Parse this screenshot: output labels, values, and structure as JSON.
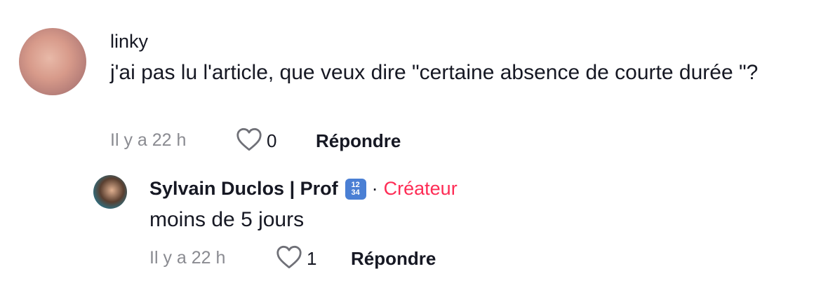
{
  "comment": {
    "username": "linky",
    "text": "j'ai pas lu l'article, que veux dire \"certaine absence de courte durée \"?",
    "time": "Il y a 22 h",
    "likes": "0",
    "reply_label": "Répondre",
    "avatar_icon": "user-avatar"
  },
  "reply": {
    "username": "Sylvain Duclos | Prof",
    "emoji": "1234",
    "separator": "·",
    "creator_badge": "Créateur",
    "text": "moins de 5 jours",
    "time": "Il y a 22 h",
    "likes": "1",
    "reply_label": "Répondre",
    "avatar_icon": "user-avatar"
  },
  "colors": {
    "creator_badge": "#fe2c55",
    "meta": "#8a8b91",
    "text": "#161823"
  }
}
